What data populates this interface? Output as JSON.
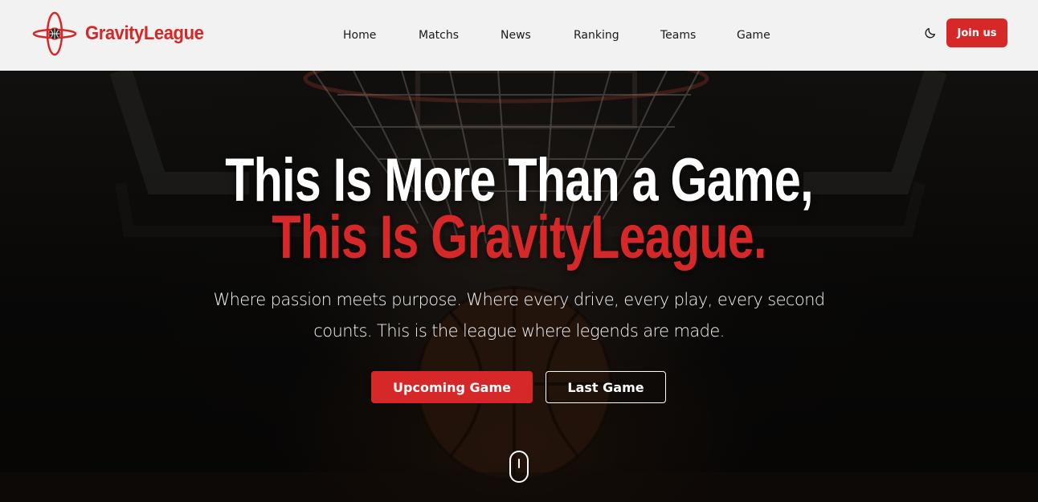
{
  "brand": {
    "name": "GravityLeague",
    "logo_icon": "basketball-orbit-logo",
    "accent_color": "#d62828"
  },
  "nav": {
    "items": [
      {
        "label": "Home"
      },
      {
        "label": "Matchs"
      },
      {
        "label": "News"
      },
      {
        "label": "Ranking"
      },
      {
        "label": "Teams"
      },
      {
        "label": "Game"
      }
    ],
    "theme_toggle_icon": "moon-icon",
    "join_label": "Join us"
  },
  "hero": {
    "headline_line1": "This Is More Than a Game,",
    "headline_line2": "This Is GravityLeague.",
    "subtitle": "Where passion meets purpose. Where every drive, every play, every second counts. This is the league where legends are made.",
    "primary_button": "Upcoming Game",
    "secondary_button": "Last Game",
    "scroll_icon": "mouse-scroll-icon",
    "background": "basketball-hoop-net-photo"
  }
}
